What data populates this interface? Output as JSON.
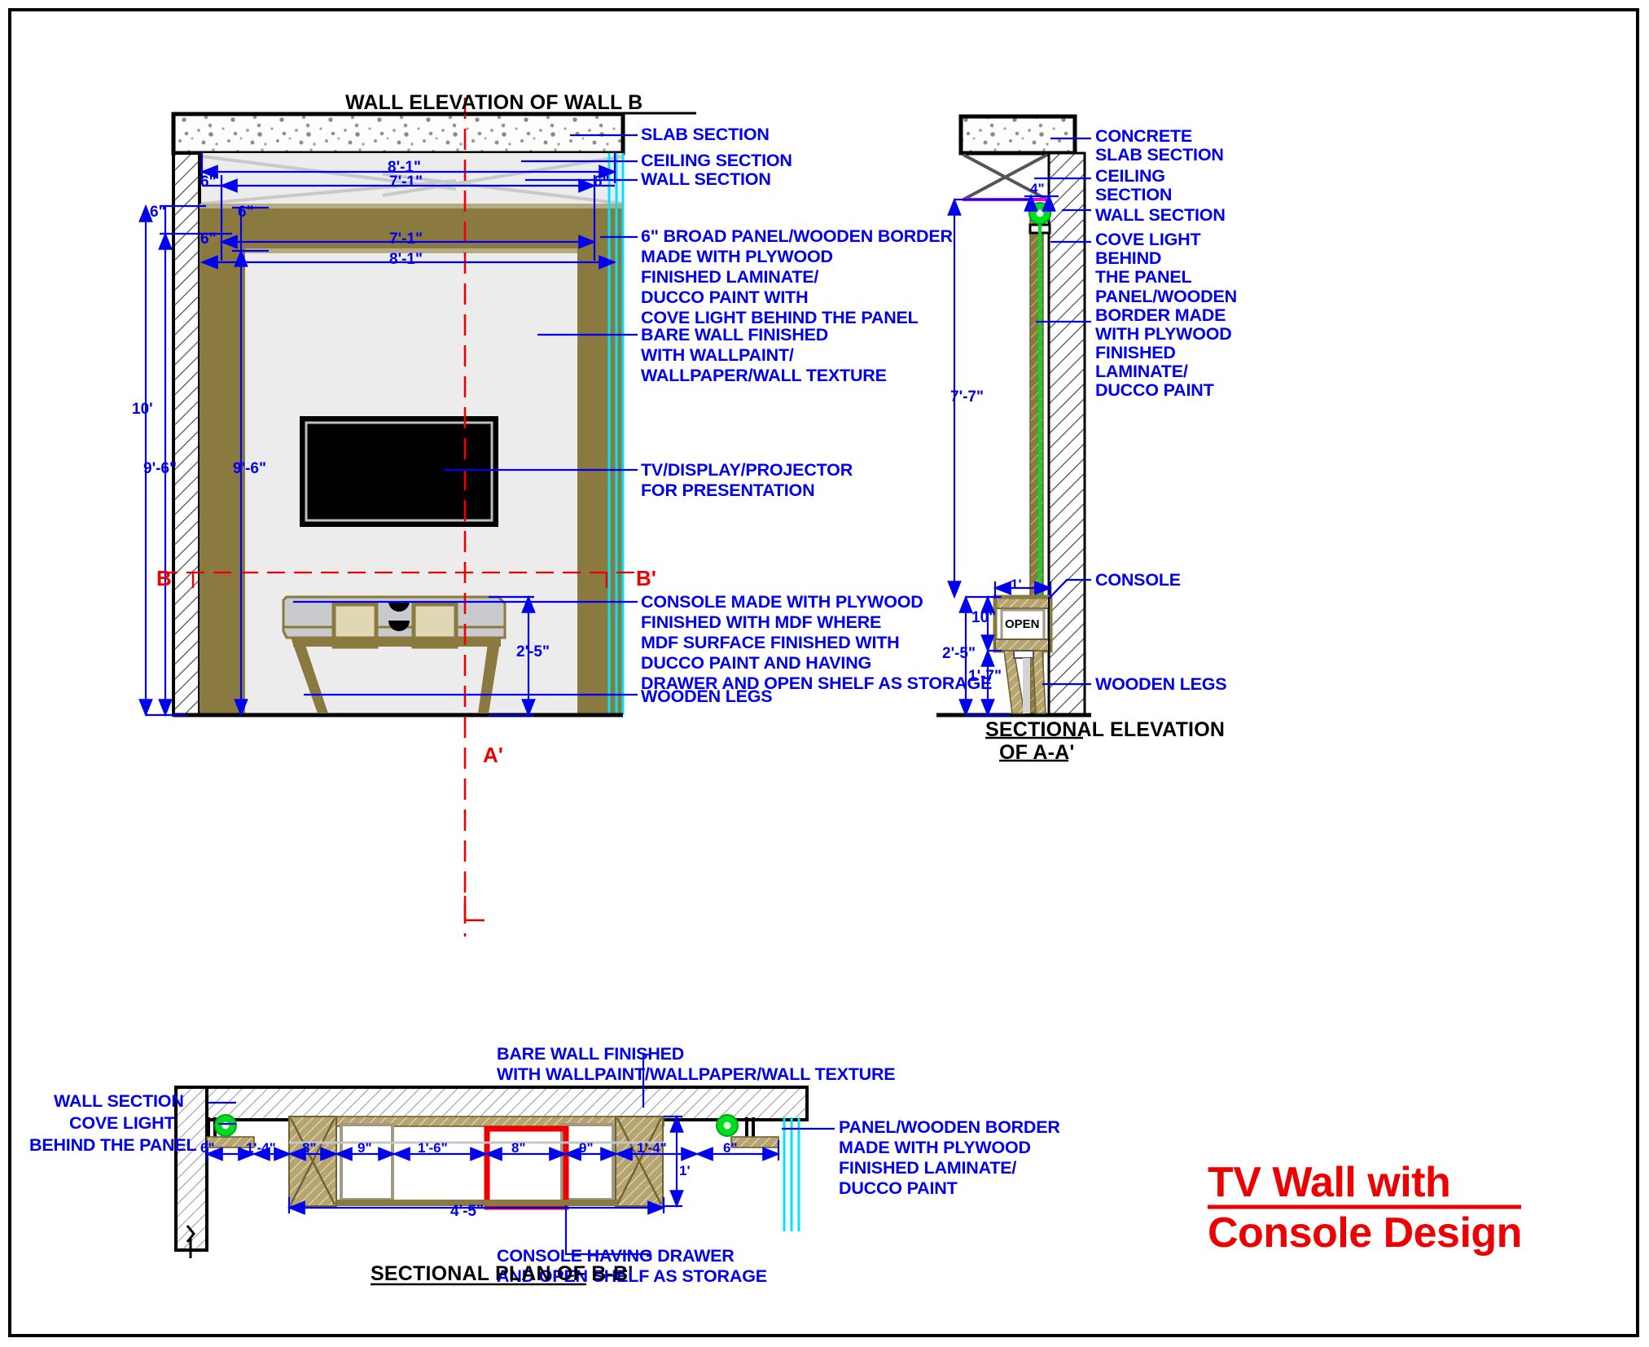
{
  "sheet": {
    "main_title_line1": "TV Wall with",
    "main_title_line2": "Console Design"
  },
  "views": {
    "elevation_b": {
      "title": "WALL ELEVATION OF WALL B",
      "annotations": [
        "SLAB SECTION",
        "CEILING SECTION",
        "WALL SECTION",
        "6\" BROAD PANEL/WOODEN BORDER",
        "MADE WITH PLYWOOD",
        "FINISHED LAMINATE/",
        "DUCCO PAINT WITH",
        "COVE LIGHT BEHIND THE PANEL",
        "BARE WALL FINISHED",
        "WITH WALLPAINT/",
        "WALLPAPER/WALL TEXTURE",
        "TV/DISPLAY/PROJECTOR",
        "FOR PRESENTATION",
        "CONSOLE MADE WITH PLYWOOD",
        "FINISHED WITH MDF WHERE",
        "MDF SURFACE FINISHED WITH",
        "DUCCO PAINT AND HAVING",
        "DRAWER AND OPEN SHELF AS STORAGE",
        "WOODEN LEGS"
      ],
      "dimensions": {
        "top_width_outer": "8'-1\"",
        "top_width_inner": "7'-1\"",
        "panel_width_inner": "7'-1\"",
        "panel_width_outer": "8'-1\"",
        "border_left_top": "6\"",
        "border_right_top": "6\"",
        "border_6a": "6\"",
        "border_6b": "6\"",
        "border_6c": "6\"",
        "height_total": "10'",
        "height_wall": "9'-6\"",
        "height_panel": "9'-6\"",
        "console_height": "2'-5\""
      },
      "section_marks": {
        "b_left": "B",
        "b_right": "B'",
        "a_bottom": "A'"
      }
    },
    "section_aa": {
      "title_line1": "SECTIONAL ELEVATION",
      "title_line2": "OF A-A'",
      "annotations": [
        "CONCRETE",
        "SLAB SECTION",
        "CEILING",
        "SECTION",
        "WALL SECTION",
        "COVE LIGHT",
        "BEHIND",
        "THE PANEL",
        "PANEL/WOODEN",
        "BORDER MADE",
        "WITH PLYWOOD",
        "FINISHED",
        "LAMINATE/",
        "DUCCO PAINT",
        "CONSOLE",
        "WOODEN LEGS"
      ],
      "dimensions": {
        "cove_gap": "4\"",
        "panel_height": "7'-7\"",
        "console_depth": "1'",
        "shelf_height": "10\"",
        "console_total": "2'-5\"",
        "leg_height": "1'-7\""
      },
      "shelf_label": "OPEN"
    },
    "plan_bb": {
      "title": "SECTIONAL PLAN OF B-B'",
      "annotations": [
        "WALL SECTION",
        "COVE LIGHT",
        "BEHIND THE PANEL",
        "BARE WALL FINISHED",
        "WITH WALLPAINT/WALLPAPER/WALL TEXTURE",
        "PANEL/WOODEN BORDER",
        "MADE WITH PLYWOOD",
        "FINISHED LAMINATE/",
        "DUCCO PAINT",
        "CONSOLE HAVING DRAWER",
        "AND OPEN SHELF AS STORAGE"
      ],
      "dimensions": {
        "left_border": "6\"",
        "left_gap": "1'-4\"",
        "leg_left": "8\"",
        "shelf_left": "9\"",
        "drawer": "1'-6\"",
        "shelf_right": "8\"",
        "leg_right": "9\"",
        "right_gap": "1'-4\"",
        "right_border": "6\"",
        "console_depth": "1'",
        "console_width": "4'-5\""
      }
    }
  },
  "colors": {
    "annotation_blue": "#0000ee",
    "title_red": "#ee0000",
    "wood_panel": "#8b7a3f",
    "cove_cyan": "#00e5ff",
    "cove_light_green": "#00dd22",
    "wall_fill": "#ececec",
    "tv_black": "#000000",
    "console_grey": "#c9cace",
    "drawer_beige": "#e0d7b4"
  }
}
